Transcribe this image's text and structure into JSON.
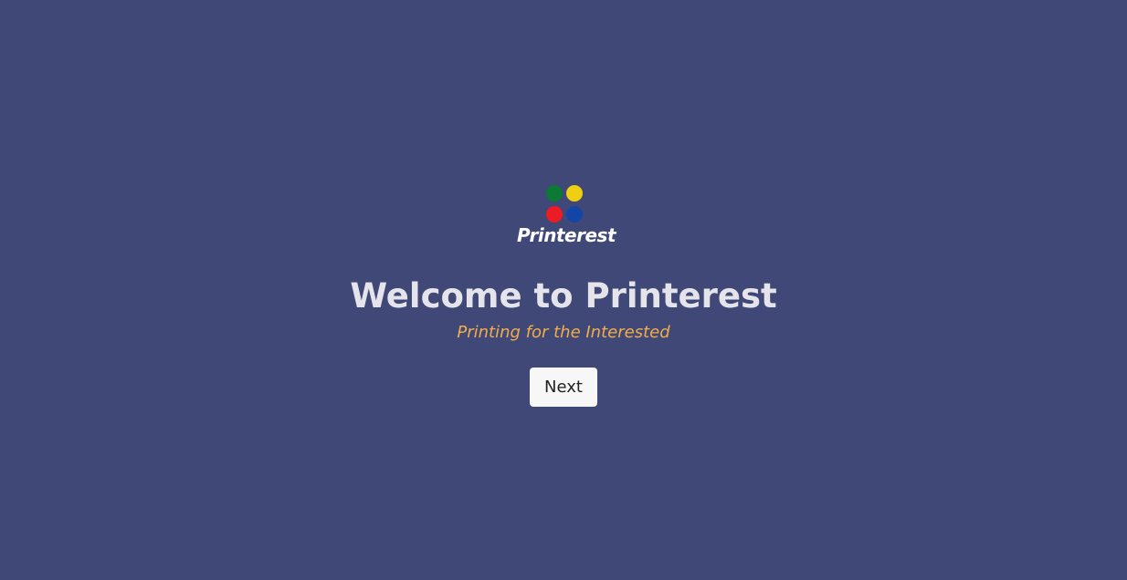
{
  "logo": {
    "text": "Printerest",
    "dot_colors": {
      "top_left": "#0a7a35",
      "top_right": "#f0cf12",
      "bottom_left": "#ec1c24",
      "bottom_right": "#1146a8"
    }
  },
  "welcome": {
    "title": "Welcome to Printerest",
    "subtitle": "Printing for the Interested"
  },
  "actions": {
    "next_label": "Next"
  },
  "colors": {
    "background": "#3f4877",
    "title": "#e4e4ea",
    "subtitle": "#f2ad4b",
    "button_bg": "#f7f7f8"
  }
}
